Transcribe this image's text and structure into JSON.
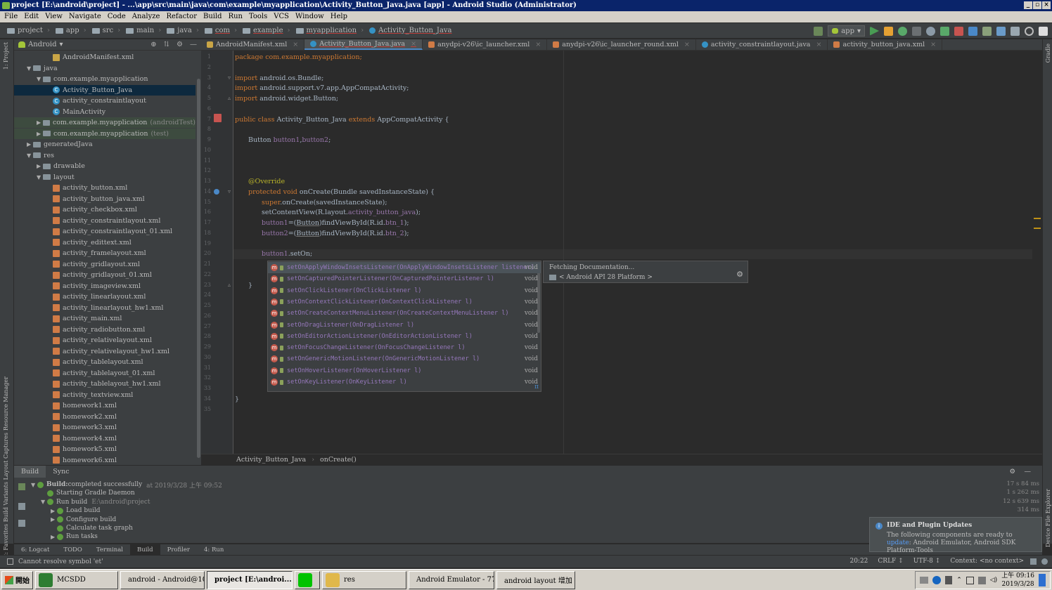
{
  "window": {
    "title": "project [E:\\android\\project] - ...\\app\\src\\main\\java\\com\\example\\myapplication\\Activity_Button_Java.java [app] - Android Studio (Administrator)",
    "controls": [
      "_",
      "▫",
      "×"
    ]
  },
  "menu": [
    "File",
    "Edit",
    "View",
    "Navigate",
    "Code",
    "Analyze",
    "Refactor",
    "Build",
    "Run",
    "Tools",
    "VCS",
    "Window",
    "Help"
  ],
  "breadcrumbs": [
    "project",
    "app",
    "src",
    "main",
    "java",
    "com",
    "example",
    "myapplication",
    "Activity_Button_Java"
  ],
  "run_config": "app",
  "project_panel": {
    "view": "Android",
    "tree": [
      {
        "label": "AndroidManifest.xml",
        "kind": "manifest",
        "depth": 3
      },
      {
        "label": "java",
        "kind": "folder",
        "depth": 1,
        "expanded": true
      },
      {
        "label": "com.example.myapplication",
        "kind": "package",
        "depth": 2,
        "expanded": true
      },
      {
        "label": "Activity_Button_Java",
        "kind": "class",
        "depth": 3,
        "selected": true
      },
      {
        "label": "activity_constraintlayout",
        "kind": "class",
        "depth": 3
      },
      {
        "label": "MainActivity",
        "kind": "class",
        "depth": 3
      },
      {
        "label": "com.example.myapplication",
        "suffix": "(androidTest)",
        "kind": "package",
        "depth": 2,
        "collapsed": true
      },
      {
        "label": "com.example.myapplication",
        "suffix": "(test)",
        "kind": "package",
        "depth": 2,
        "collapsed": true
      },
      {
        "label": "generatedJava",
        "kind": "folder",
        "depth": 1,
        "collapsed": true
      },
      {
        "label": "res",
        "kind": "folder",
        "depth": 1,
        "expanded": true
      },
      {
        "label": "drawable",
        "kind": "folder",
        "depth": 2,
        "collapsed": true
      },
      {
        "label": "layout",
        "kind": "folder",
        "depth": 2,
        "expanded": true
      },
      {
        "label": "activity_button.xml",
        "kind": "xml",
        "depth": 3
      },
      {
        "label": "activity_button_java.xml",
        "kind": "xml",
        "depth": 3
      },
      {
        "label": "activity_checkbox.xml",
        "kind": "xml",
        "depth": 3
      },
      {
        "label": "activity_constraintlayout.xml",
        "kind": "xml",
        "depth": 3
      },
      {
        "label": "activity_constraintlayout_01.xml",
        "kind": "xml",
        "depth": 3
      },
      {
        "label": "activity_edittext.xml",
        "kind": "xml",
        "depth": 3
      },
      {
        "label": "activity_framelayout.xml",
        "kind": "xml",
        "depth": 3
      },
      {
        "label": "activity_gridlayout.xml",
        "kind": "xml",
        "depth": 3
      },
      {
        "label": "activity_gridlayout_01.xml",
        "kind": "xml",
        "depth": 3
      },
      {
        "label": "activity_imageview.xml",
        "kind": "xml",
        "depth": 3
      },
      {
        "label": "activity_linearlayout.xml",
        "kind": "xml",
        "depth": 3
      },
      {
        "label": "activity_linearlayout_hw1.xml",
        "kind": "xml",
        "depth": 3
      },
      {
        "label": "activity_main.xml",
        "kind": "xml",
        "depth": 3
      },
      {
        "label": "activity_radiobutton.xml",
        "kind": "xml",
        "depth": 3
      },
      {
        "label": "activity_relativelayout.xml",
        "kind": "xml",
        "depth": 3
      },
      {
        "label": "activity_relativelayout_hw1.xml",
        "kind": "xml",
        "depth": 3
      },
      {
        "label": "activity_tablelayout.xml",
        "kind": "xml",
        "depth": 3
      },
      {
        "label": "activity_tablelayout_01.xml",
        "kind": "xml",
        "depth": 3
      },
      {
        "label": "activity_tablelayout_hw1.xml",
        "kind": "xml",
        "depth": 3
      },
      {
        "label": "activity_textview.xml",
        "kind": "xml",
        "depth": 3
      },
      {
        "label": "homework1.xml",
        "kind": "xml",
        "depth": 3
      },
      {
        "label": "homework2.xml",
        "kind": "xml",
        "depth": 3
      },
      {
        "label": "homework3.xml",
        "kind": "xml",
        "depth": 3
      },
      {
        "label": "homework4.xml",
        "kind": "xml",
        "depth": 3
      },
      {
        "label": "homework5.xml",
        "kind": "xml",
        "depth": 3
      },
      {
        "label": "homework6.xml",
        "kind": "xml",
        "depth": 3
      }
    ]
  },
  "editor_tabs": [
    {
      "label": "AndroidManifest.xml",
      "icon": "manifest",
      "active": false
    },
    {
      "label": "Activity_Button_Java.java",
      "icon": "class",
      "active": true
    },
    {
      "label": "anydpi-v26\\ic_launcher.xml",
      "icon": "xml",
      "active": false
    },
    {
      "label": "anydpi-v26\\ic_launcher_round.xml",
      "icon": "xml",
      "active": false
    },
    {
      "label": "activity_constraintlayout.java",
      "icon": "class",
      "active": false
    },
    {
      "label": "activity_button_java.xml",
      "icon": "xml",
      "active": false
    }
  ],
  "line_numbers": [
    "1",
    "2",
    "3",
    "4",
    "5",
    "6",
    "7",
    "8",
    "9",
    "10",
    "11",
    "12",
    "13",
    "14",
    "15",
    "16",
    "17",
    "18",
    "19",
    "20",
    "21",
    "22",
    "23",
    "24",
    "25",
    "26",
    "27",
    "28",
    "29",
    "30",
    "31",
    "32",
    "33",
    "34",
    "35"
  ],
  "code": {
    "l1": "package com.example.myapplication;",
    "l3_kw": "import",
    "l3": " android.os.Bundle;",
    "l4_kw": "import",
    "l4": " android.support.v7.app.AppCompatActivity;",
    "l5_kw": "import",
    "l5": " android.widget.Button;",
    "l7_kw1": "public class",
    "l7_a": " Activity_Button_Java ",
    "l7_kw2": "extends",
    "l7_b": " AppCompatActivity {",
    "l9_a": "Button ",
    "l9_f": "button1",
    "l9_b": ",",
    "l9_f2": "button2",
    "l9_c": ";",
    "l13": "@Override",
    "l14_kw": "protected void",
    "l14_m": " onCreate",
    "l14_b": "(Bundle savedInstanceState) {",
    "l15_kw": "super",
    "l15": ".onCreate(savedInstanceState);",
    "l16_a": "setContentView(R.layout.",
    "l16_f": "activity_button_java",
    "l16_b": ");",
    "l17_f": "button1",
    "l17_a": "=(",
    "l17_t": "Button",
    "l17_b": ")findViewById(R.id.",
    "l17_f2": "btn_1",
    "l17_c": ");",
    "l18_f": "button2",
    "l18_a": "=(",
    "l18_t": "Button",
    "l18_b": ")findViewById(R.id.",
    "l18_f2": "btn_2",
    "l18_c": ");",
    "l20_f": "button1",
    "l20": ".setOn;",
    "l23": "}",
    "l34": "}"
  },
  "completion": [
    {
      "name": "setOnApplyWindowInsetsListener(OnApplyWindowInsetsListener listener)",
      "ret": "void",
      "selected": true
    },
    {
      "name": "setOnCapturedPointerListener(OnCapturedPointerListener l)",
      "ret": "void"
    },
    {
      "name": "setOnClickListener(OnClickListener l)",
      "ret": "void"
    },
    {
      "name": "setOnContextClickListener(OnContextClickListener l)",
      "ret": "void"
    },
    {
      "name": "setOnCreateContextMenuListener(OnCreateContextMenuListener l)",
      "ret": "void"
    },
    {
      "name": "setOnDragListener(OnDragListener l)",
      "ret": "void"
    },
    {
      "name": "setOnEditorActionListener(OnEditorActionListener l)",
      "ret": "void"
    },
    {
      "name": "setOnFocusChangeListener(OnFocusChangeListener l)",
      "ret": "void"
    },
    {
      "name": "setOnGenericMotionListener(OnGenericMotionListener l)",
      "ret": "void"
    },
    {
      "name": "setOnHoverListener(OnHoverListener l)",
      "ret": "void"
    },
    {
      "name": "setOnKeyListener(OnKeyListener l)",
      "ret": "void"
    }
  ],
  "completion_footer": "π",
  "doc_popup": {
    "status": "Fetching Documentation...",
    "platform": "< Android API 28 Platform >"
  },
  "editor_breadcrumb": [
    "Activity_Button_Java",
    "onCreate()"
  ],
  "build_panel": {
    "tabs": [
      "Build",
      "Sync"
    ],
    "lines": [
      {
        "bold": "Build:",
        "text": " completed successfully",
        "extra": "at 2019/3/28 上午 09:52",
        "time": "17 s 84 ms"
      },
      {
        "text": "Starting Gradle Daemon",
        "time": "1 s 262 ms"
      },
      {
        "text": "Run build",
        "extra": "E:\\android\\project",
        "time": "12 s 639 ms"
      },
      {
        "text": "Load build",
        "time": "314 ms"
      },
      {
        "text": "Configure build",
        "time": ""
      },
      {
        "text": "Calculate task graph",
        "time": ""
      },
      {
        "text": "Run tasks",
        "time": ""
      }
    ]
  },
  "bottom_tabs": [
    "6: Logcat",
    "TODO",
    "Terminal",
    "Build",
    "Profiler",
    "4: Run"
  ],
  "notification": {
    "title": "IDE and Plugin Updates",
    "body_a": "The following components are ready to ",
    "link": "update",
    "body_b": ": Android Emulator, Android SDK Platform-Tools"
  },
  "status": {
    "message": "Cannot resolve symbol 'et'",
    "position": "20:22",
    "line_sep": "CRLF ↕",
    "encoding": "UTF-8 ↕",
    "context": "Context: <no context>"
  },
  "taskbar": {
    "start": "開始",
    "tasks": [
      {
        "label": "MCSDD",
        "color": "#2e7d32"
      },
      {
        "label": "android - Android@10...",
        "color": "#b71c1c"
      },
      {
        "label": "project [E:\\androi...",
        "color": "#7cb342",
        "pressed": true
      },
      {
        "label": "",
        "color": "#00c300"
      },
      {
        "label": "res",
        "color": "#e0b84a"
      },
      {
        "label": "Android Emulator - 77...",
        "color": "#8bc34a"
      },
      {
        "label": "android layout 增加 ...",
        "color": "#4285f4"
      }
    ],
    "clock_time": "上午 09:16",
    "clock_date": "2019/3/28"
  },
  "colors": {
    "accent": "#4a88c7",
    "editor_bg": "#2b2b2b",
    "panel_bg": "#3c3f41",
    "keyword": "#cc7832",
    "field": "#9876aa",
    "annotation": "#bbb529"
  }
}
